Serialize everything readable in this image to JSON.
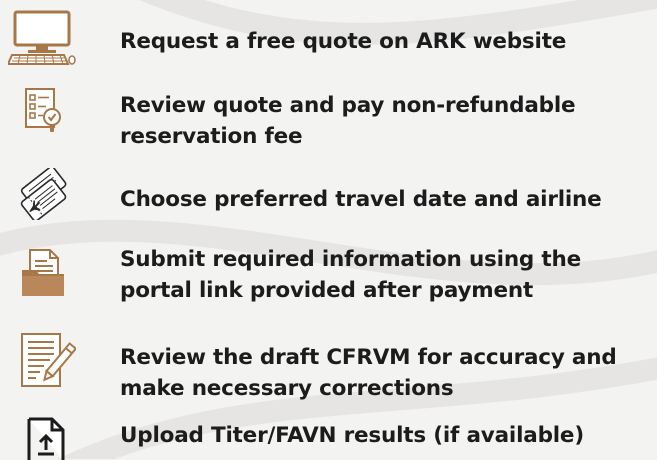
{
  "steps": [
    {
      "icon": "desktop-computer-icon",
      "lines": [
        "Request a free quote on ARK website"
      ]
    },
    {
      "icon": "checklist-review-icon",
      "lines": [
        "Review quote and pay non-refundable",
        "reservation fee"
      ]
    },
    {
      "icon": "plane-tickets-icon",
      "lines": [
        "Choose preferred travel date and airline"
      ]
    },
    {
      "icon": "document-folder-icon",
      "lines": [
        "Submit required information using the",
        "portal link provided after payment"
      ]
    },
    {
      "icon": "document-edit-icon",
      "lines": [
        "Review the draft CFRVM for accuracy and",
        "make necessary corrections"
      ]
    },
    {
      "icon": "file-upload-icon",
      "lines": [
        "Upload Titer/FAVN results (if available)"
      ]
    }
  ],
  "colors": {
    "brown": "#a87748",
    "text": "#1c1c1c",
    "background": "#f3f3f2"
  }
}
